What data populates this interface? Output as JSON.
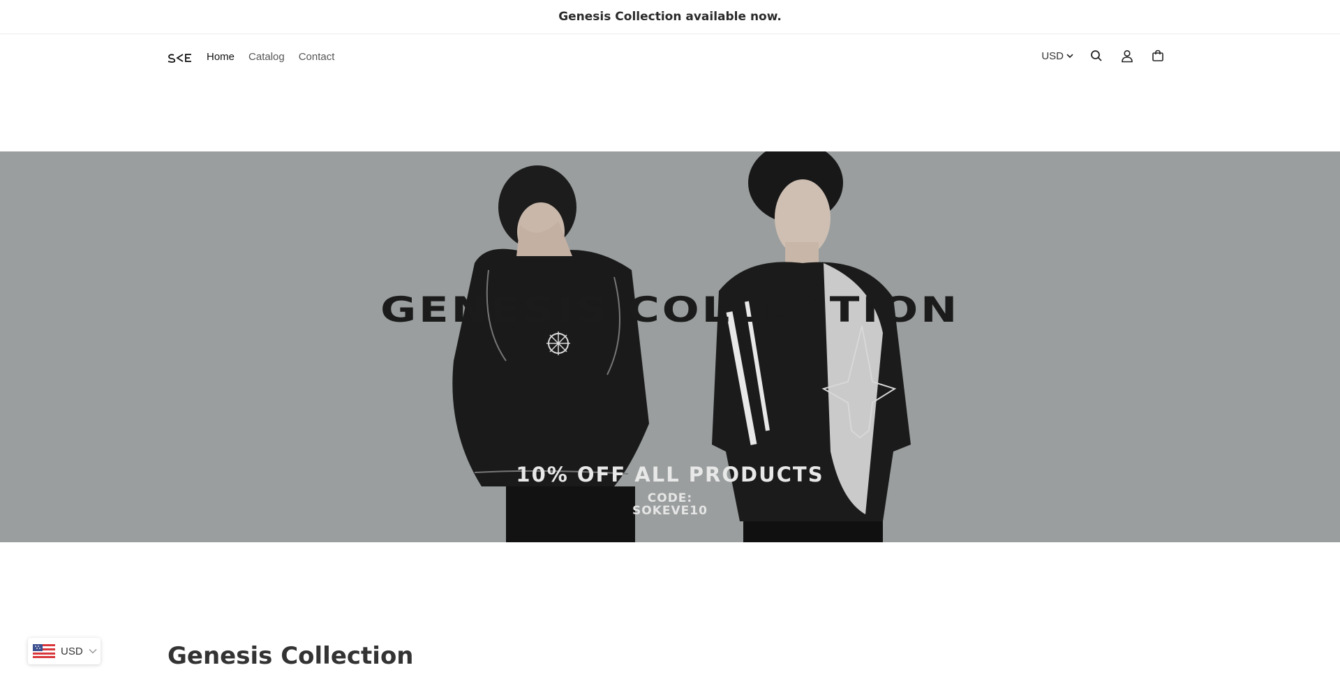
{
  "announcement": {
    "text": "Genesis Collection available now."
  },
  "header": {
    "logo_icon": "ske-logo",
    "nav": [
      {
        "label": "Home",
        "active": true
      },
      {
        "label": "Catalog",
        "active": false
      },
      {
        "label": "Contact",
        "active": false
      }
    ],
    "currency": "USD",
    "icons": [
      "search-icon",
      "account-icon",
      "cart-icon"
    ]
  },
  "hero": {
    "title": "GENESIS COLLECTION",
    "promo": "10% OFF ALL PRODUCTS",
    "code_label": "CODE:",
    "code_value": "SOKEVE10",
    "background_color": "#9a9e9e"
  },
  "main": {
    "section_title": "Genesis Collection"
  },
  "currency_widget": {
    "flag_icon": "us-flag-icon",
    "currency": "USD"
  }
}
